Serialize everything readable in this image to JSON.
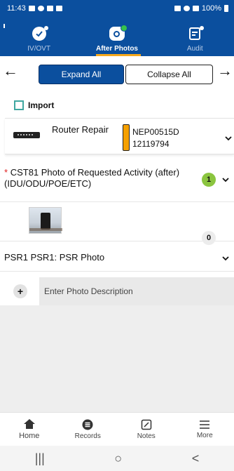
{
  "status_bar": {
    "time": "11:43",
    "battery": "100%"
  },
  "tabs": [
    {
      "label": "IV/OVT",
      "icon": "check-circle-icon",
      "active": false
    },
    {
      "label": "After Photos",
      "icon": "camera-icon",
      "active": true
    },
    {
      "label": "Audit",
      "icon": "clipboard-icon",
      "active": false
    }
  ],
  "toolbar": {
    "expand_label": "Expand All",
    "collapse_label": "Collapse All"
  },
  "import": {
    "label": "Import",
    "checked": false
  },
  "device": {
    "name": "Router Repair",
    "id_line1": "NEP00515D",
    "id_line2": "12119794"
  },
  "sections": {
    "cst": {
      "required_mark": "*",
      "title": "CST81 Photo of Requested Activity (after) (IDU/ODU/POE/ETC)",
      "count": "1"
    },
    "psr": {
      "title": "PSR1 PSR1: PSR Photo",
      "count": "0"
    }
  },
  "description": {
    "placeholder": "Enter Photo Description"
  },
  "bottom_nav": [
    {
      "label": "Home",
      "icon": "home-icon"
    },
    {
      "label": "Records",
      "icon": "records-icon"
    },
    {
      "label": "Notes",
      "icon": "notes-icon"
    },
    {
      "label": "More",
      "icon": "menu-icon"
    }
  ],
  "system_nav": {
    "recents": "|||",
    "home": "○",
    "back": "<"
  },
  "colors": {
    "brand": "#0b4f9e",
    "accent": "#f6a81c",
    "badge_green": "#8bc53f",
    "device_tag": "#f5a000"
  }
}
